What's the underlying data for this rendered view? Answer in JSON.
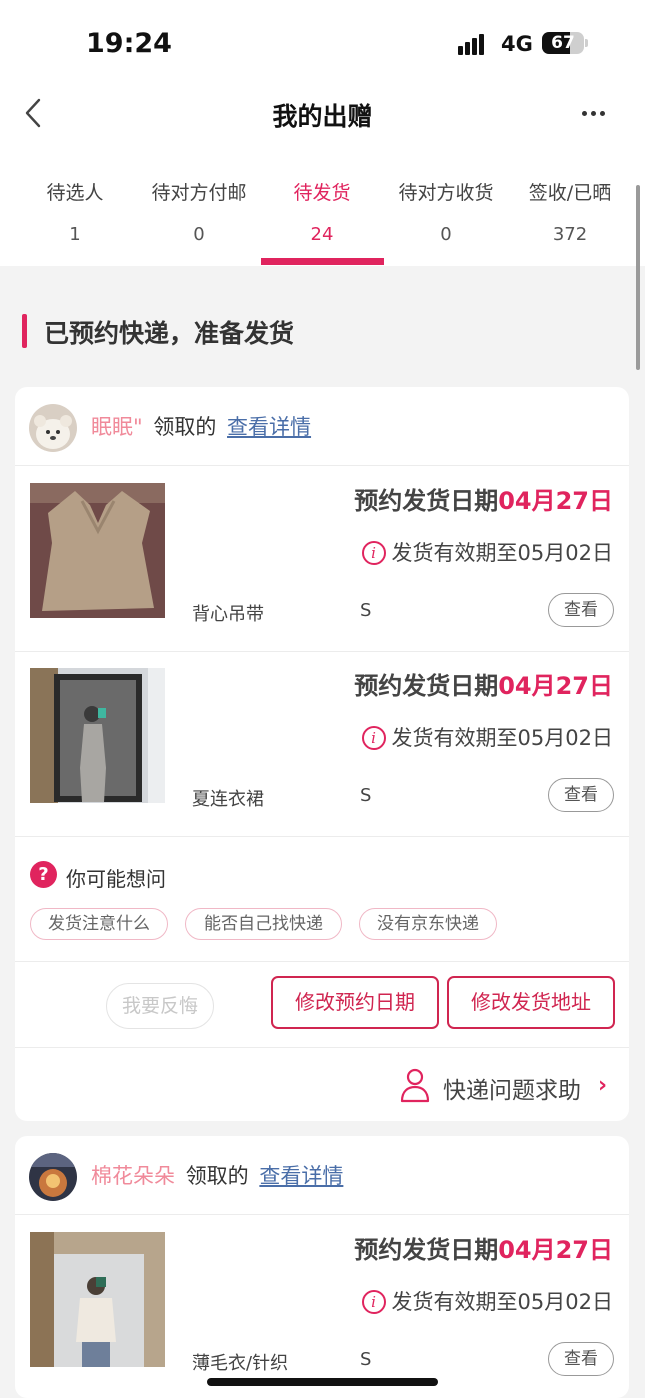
{
  "status_bar": {
    "time": "19:24",
    "network": "4G",
    "battery": "67",
    "battery_level": 0.67
  },
  "nav": {
    "title": "我的出赠",
    "back_icon": "chevron-left-icon",
    "more_icon": "more-dots-icon"
  },
  "tabs": [
    {
      "label": "待选人",
      "count": "1"
    },
    {
      "label": "待对方付邮",
      "count": "0"
    },
    {
      "label": "待发货",
      "count": "24",
      "active": true
    },
    {
      "label": "待对方收货",
      "count": "0"
    },
    {
      "label": "签收/已晒",
      "count": "372"
    }
  ],
  "section": {
    "title": "已预约快递，准备发货"
  },
  "cards": [
    {
      "receiver": "眠眠\"",
      "claimed": "领取的",
      "detail_link": "查看详情",
      "items": [
        {
          "ship_label": "预约发货日期",
          "ship_date": "04月27日",
          "valid": "发货有效期至05月02日",
          "name": "背心吊带",
          "size": "S",
          "view": "查看"
        },
        {
          "ship_label": "预约发货日期",
          "ship_date": "04月27日",
          "valid": "发货有效期至05月02日",
          "name": "夏连衣裙",
          "size": "S",
          "view": "查看"
        }
      ],
      "faq": {
        "title": "你可能想问",
        "chips": [
          "发货注意什么",
          "能否自己找快递",
          "没有京东快递"
        ]
      },
      "actions": {
        "regret": "我要反悔",
        "change_date": "修改预约日期",
        "change_address": "修改发货地址"
      },
      "help": {
        "label": "快递问题求助"
      }
    },
    {
      "receiver": "棉花朵朵",
      "claimed": "领取的",
      "detail_link": "查看详情",
      "items": [
        {
          "ship_label": "预约发货日期",
          "ship_date": "04月27日",
          "valid": "发货有效期至05月02日",
          "name": "薄毛衣/针织",
          "size": "S",
          "view": "查看"
        }
      ]
    }
  ],
  "colors": {
    "accent": "#e0245e",
    "link": "#4a6ea8",
    "background": "#f3f3f3"
  }
}
